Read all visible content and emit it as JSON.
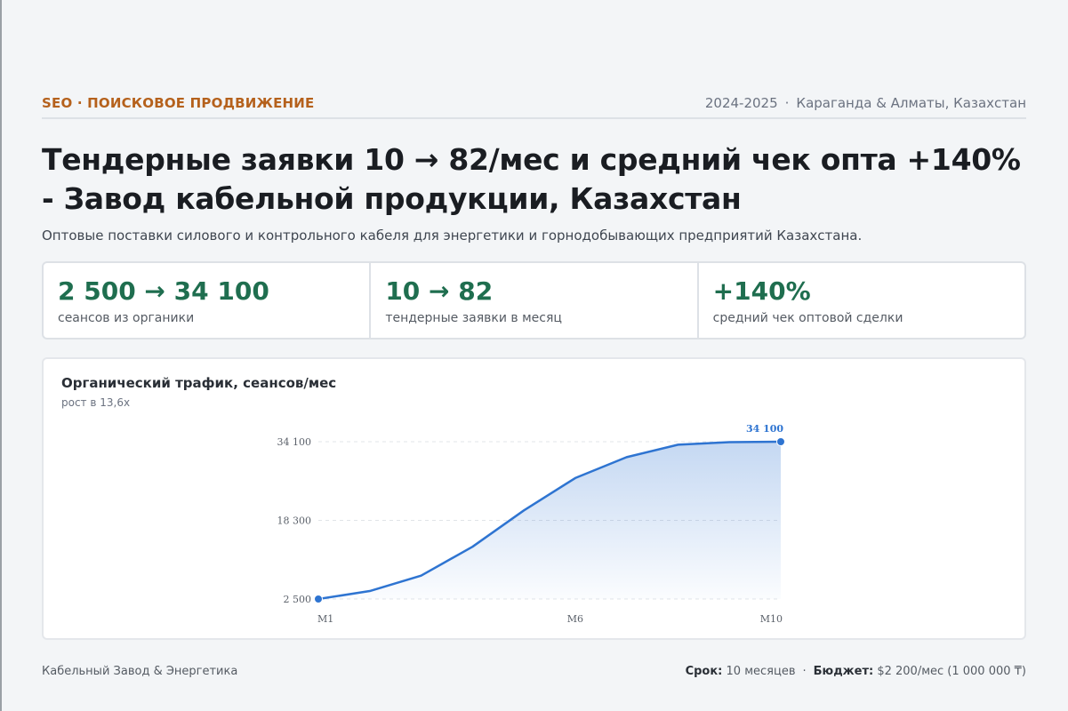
{
  "header": {
    "eyebrow": "SEO · ПОИСКОВОЕ ПРОДВИЖЕНИЕ",
    "years": "2024-2025",
    "location": "Караганда & Алматы, Казахстан"
  },
  "title": "Тендерные заявки 10 → 82/мес и средний чек опта +140% - Завод кабельной продукции, Казахстан",
  "subtitle": "Оптовые поставки силового и контрольного кабеля для энергетики и горнодобывающих предприятий Казахстана.",
  "stats": [
    {
      "value": "2 500 → 34 100",
      "label": "сеансов из органики"
    },
    {
      "value": "10 → 82",
      "label": "тендерные заявки в месяц"
    },
    {
      "value": "+140%",
      "label": "средний чек оптовой сделки"
    }
  ],
  "chart_data": {
    "type": "area",
    "title": "Органический трафик, сеансов/мес",
    "subtitle": "рост в 13,6х",
    "x": [
      "M1",
      "M2",
      "M3",
      "M4",
      "M5",
      "M6",
      "M7",
      "M8",
      "M9",
      "M10"
    ],
    "values": [
      2500,
      4100,
      7200,
      13000,
      20300,
      26800,
      31000,
      33500,
      34000,
      34100
    ],
    "yticks": [
      "2 500",
      "18 300",
      "34 100"
    ],
    "ytick_values": [
      2500,
      18300,
      34100
    ],
    "xticks": [
      "M1",
      "M6",
      "M10"
    ],
    "ylim": [
      2500,
      34100
    ],
    "end_label": "34 100",
    "color": "#2e74d1",
    "grid": true
  },
  "footer": {
    "company": "Кабельный Завод & Энергетика",
    "term_label": "Срок:",
    "term_value": "10 месяцев",
    "budget_label": "Бюджет:",
    "budget_value": "$2 200/мес (1 000 000 ₸)"
  }
}
